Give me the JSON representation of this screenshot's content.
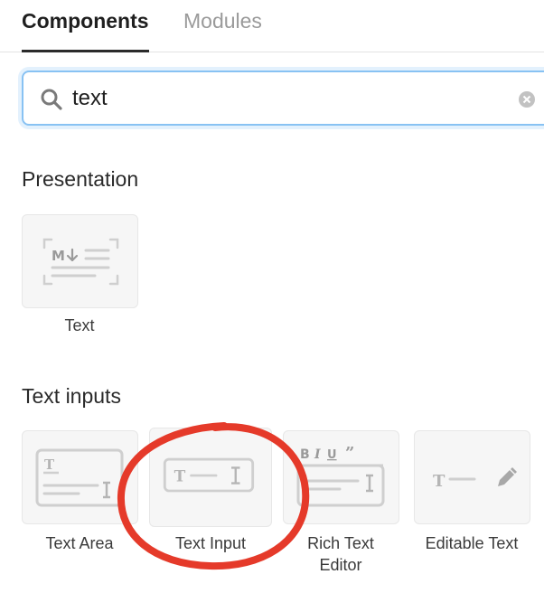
{
  "tabs": {
    "components": "Components",
    "modules": "Modules"
  },
  "search": {
    "value": "text"
  },
  "sections": {
    "presentation": {
      "title": "Presentation",
      "items": [
        {
          "label": "Text",
          "icon": "markdown-text-icon"
        }
      ]
    },
    "text_inputs": {
      "title": "Text inputs",
      "items": [
        {
          "label": "Text Area",
          "icon": "text-area-icon"
        },
        {
          "label": "Text Input",
          "icon": "text-input-icon"
        },
        {
          "label": "Rich Text",
          "label_line2": "Editor",
          "icon": "rich-text-editor-icon"
        },
        {
          "label": "Editable Text",
          "icon": "editable-text-icon"
        }
      ]
    }
  },
  "annotation": {
    "color": "#e53a2a",
    "target": "Text Input"
  },
  "colors": {
    "accent_focus": "#88c2f3",
    "icon_gray": "#cfcfcf",
    "tile_bg": "#f6f6f6"
  }
}
